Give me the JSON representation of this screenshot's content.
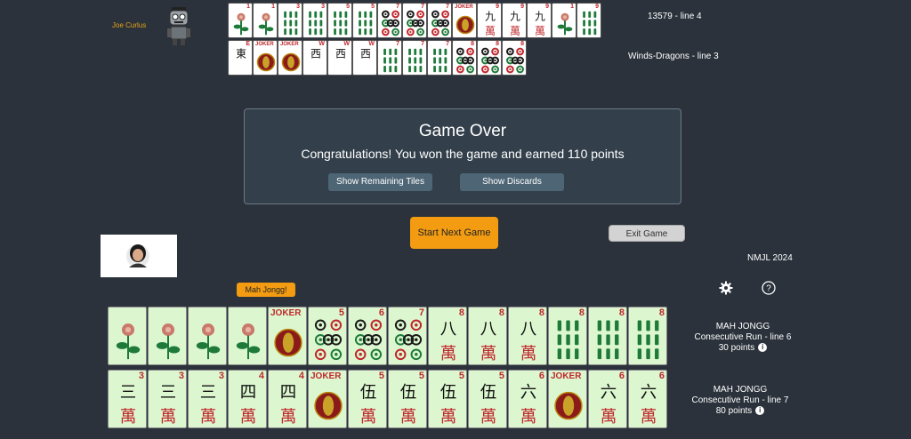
{
  "opponent": {
    "name": "Joe Curlus",
    "hand_line": "13579 - line 4",
    "hand_line_2": "Winds-Dragons - line 3"
  },
  "top_row_1": [
    {
      "kind": "flower",
      "num": "1"
    },
    {
      "kind": "flower",
      "num": "1"
    },
    {
      "kind": "bam",
      "num": "3"
    },
    {
      "kind": "bam",
      "num": "3"
    },
    {
      "kind": "bam",
      "num": "5"
    },
    {
      "kind": "bam",
      "num": "5"
    },
    {
      "kind": "dot",
      "num": "7"
    },
    {
      "kind": "dot",
      "num": "7"
    },
    {
      "kind": "dot",
      "num": "7"
    },
    {
      "kind": "joker",
      "num": ""
    },
    {
      "kind": "crak",
      "num": "9",
      "char": "九"
    },
    {
      "kind": "crak",
      "num": "9",
      "char": "九"
    },
    {
      "kind": "crak",
      "num": "9",
      "char": "九"
    },
    {
      "kind": "flower",
      "num": "1"
    },
    {
      "kind": "bam",
      "num": "9"
    }
  ],
  "top_row_2": [
    {
      "kind": "wind",
      "num": "E",
      "char": "東"
    },
    {
      "kind": "joker",
      "num": ""
    },
    {
      "kind": "joker",
      "num": ""
    },
    {
      "kind": "wind",
      "num": "W",
      "char": "西"
    },
    {
      "kind": "wind",
      "num": "W",
      "char": "西"
    },
    {
      "kind": "wind",
      "num": "W",
      "char": "西"
    },
    {
      "kind": "bam",
      "num": "7"
    },
    {
      "kind": "bam",
      "num": "7"
    },
    {
      "kind": "bam",
      "num": "7"
    },
    {
      "kind": "dot",
      "num": "8"
    },
    {
      "kind": "dot",
      "num": "8"
    },
    {
      "kind": "dot",
      "num": "8"
    }
  ],
  "game_over": {
    "title": "Game Over",
    "message": "Congratulations! You won the game and earned 110 points",
    "show_remaining": "Show Remaining Tiles",
    "show_discards": "Show Discards"
  },
  "buttons": {
    "start_next": "Start Next Game",
    "exit": "Exit Game"
  },
  "player": {
    "badge": "Mah Jongg!",
    "season": "NMJL 2024"
  },
  "hand_row_1": [
    {
      "kind": "flower",
      "num": ""
    },
    {
      "kind": "flower",
      "num": ""
    },
    {
      "kind": "flower",
      "num": ""
    },
    {
      "kind": "flower",
      "num": ""
    },
    {
      "kind": "joker",
      "num": ""
    },
    {
      "kind": "dot",
      "num": "5"
    },
    {
      "kind": "dot",
      "num": "6"
    },
    {
      "kind": "dot",
      "num": "7"
    },
    {
      "kind": "crak",
      "num": "8",
      "char": "八"
    },
    {
      "kind": "crak",
      "num": "8",
      "char": "八"
    },
    {
      "kind": "crak",
      "num": "8",
      "char": "八"
    },
    {
      "kind": "bamw",
      "num": "8"
    },
    {
      "kind": "bamw",
      "num": "8"
    },
    {
      "kind": "bamw",
      "num": "8"
    }
  ],
  "hand_row_2": [
    {
      "kind": "crak",
      "num": "3",
      "char": "三"
    },
    {
      "kind": "crak",
      "num": "3",
      "char": "三"
    },
    {
      "kind": "crak",
      "num": "3",
      "char": "三"
    },
    {
      "kind": "crak",
      "num": "4",
      "char": "四"
    },
    {
      "kind": "crak",
      "num": "4",
      "char": "四"
    },
    {
      "kind": "joker",
      "num": ""
    },
    {
      "kind": "crak",
      "num": "5",
      "char": "伍"
    },
    {
      "kind": "crak",
      "num": "5",
      "char": "伍"
    },
    {
      "kind": "crak",
      "num": "5",
      "char": "伍"
    },
    {
      "kind": "crak",
      "num": "5",
      "char": "伍"
    },
    {
      "kind": "crak",
      "num": "6",
      "char": "六"
    },
    {
      "kind": "joker",
      "num": ""
    },
    {
      "kind": "crak",
      "num": "6",
      "char": "六"
    },
    {
      "kind": "crak",
      "num": "6",
      "char": "六"
    }
  ],
  "hand_info_1": {
    "title": "MAH JONGG",
    "line": "Consecutive Run - line 6",
    "points": "30 points"
  },
  "hand_info_2": {
    "title": "MAH JONGG",
    "line": "Consecutive Run - line 7",
    "points": "80 points"
  },
  "icons": {
    "settings": "gear-icon",
    "help": "question-icon",
    "info": "info-icon",
    "joker_text": "JOKER",
    "wan_char": "萬",
    "info_glyph": "i",
    "help_glyph": "?"
  },
  "colors": {
    "background": "#2b323b",
    "accent": "#f39c12",
    "tile_face": "#dcf7cf",
    "red": "#c0282d",
    "green": "#1f7a3a"
  }
}
